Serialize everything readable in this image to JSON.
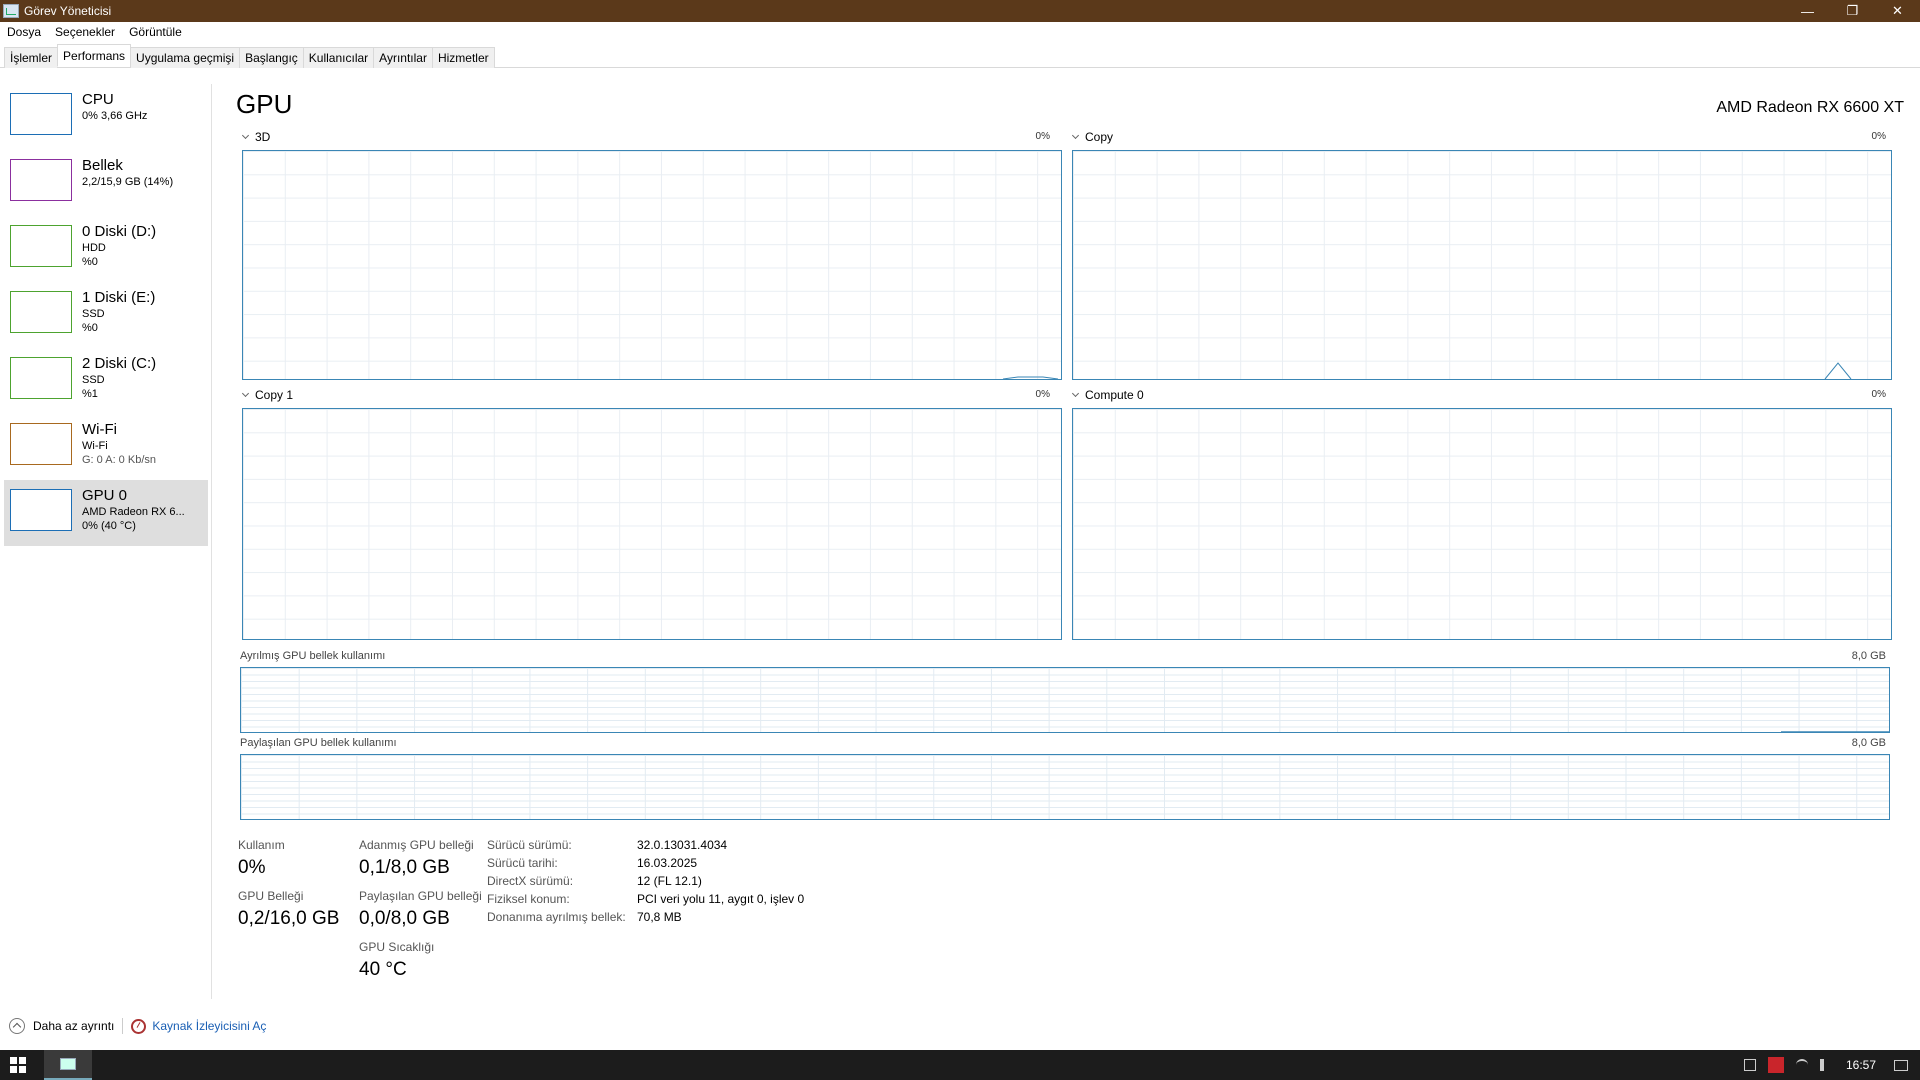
{
  "window": {
    "title": "Görev Yöneticisi",
    "minimize": "—",
    "maximize": "❐",
    "close": "✕"
  },
  "menu": [
    "Dosya",
    "Seçenekler",
    "Görüntüle"
  ],
  "tabs": [
    {
      "label": "İşlemler",
      "active": false
    },
    {
      "label": "Performans",
      "active": true
    },
    {
      "label": "Uygulama geçmişi",
      "active": false
    },
    {
      "label": "Başlangıç",
      "active": false
    },
    {
      "label": "Kullanıcılar",
      "active": false
    },
    {
      "label": "Ayrıntılar",
      "active": false
    },
    {
      "label": "Hizmetler",
      "active": false
    }
  ],
  "sidebar": [
    {
      "name": "CPU",
      "line1": "0% 3,66 GHz",
      "line2": "",
      "color": "#1c6eb5"
    },
    {
      "name": "Bellek",
      "line1": "2,2/15,9 GB (14%)",
      "line2": "",
      "color": "#8b2f9e"
    },
    {
      "name": "0 Diski (D:)",
      "line1": "HDD",
      "line2": "%0",
      "color": "#4da32f"
    },
    {
      "name": "1 Diski (E:)",
      "line1": "SSD",
      "line2": "%0",
      "color": "#4da32f"
    },
    {
      "name": "2 Diski (C:)",
      "line1": "SSD",
      "line2": "%1",
      "color": "#4da32f"
    },
    {
      "name": "Wi-Fi",
      "line1": "Wi-Fi",
      "line2": "G: 0 A: 0 Kb/sn",
      "color": "#a8691f"
    },
    {
      "name": "GPU 0",
      "line1": "AMD Radeon RX 6...",
      "line2": "0% (40 °C)",
      "color": "#1c6eb5"
    }
  ],
  "main": {
    "title": "GPU",
    "model": "AMD Radeon RX 6600 XT",
    "engines": [
      {
        "label": "3D",
        "pct": "0%"
      },
      {
        "label": "Copy",
        "pct": "0%"
      },
      {
        "label": "Copy 1",
        "pct": "0%"
      },
      {
        "label": "Compute 0",
        "pct": "0%"
      }
    ],
    "dedicated_label": "Ayrılmış GPU bellek kullanımı",
    "dedicated_max": "8,0 GB",
    "shared_label": "Paylaşılan GPU bellek kullanımı",
    "shared_max": "8,0 GB"
  },
  "stats": {
    "usage_label": "Kullanım",
    "usage_value": "0%",
    "gpu_mem_label": "GPU Belleği",
    "gpu_mem_value": "0,2/16,0 GB",
    "dedicated_label": "Adanmış GPU belleği",
    "dedicated_value": "0,1/8,0 GB",
    "shared_label": "Paylaşılan GPU belleği",
    "shared_value": "0,0/8,0 GB",
    "temp_label": "GPU Sıcaklığı",
    "temp_value": "40 °C"
  },
  "details": [
    {
      "key": "Sürücü sürümü:",
      "value": "32.0.13031.4034"
    },
    {
      "key": "Sürücü tarihi:",
      "value": "16.03.2025"
    },
    {
      "key": "DirectX sürümü:",
      "value": "12 (FL 12.1)"
    },
    {
      "key": "Fiziksel konum:",
      "value": "PCI veri yolu 11, aygıt 0, işlev 0"
    },
    {
      "key": "Donanıma ayrılmış bellek:",
      "value": "70,8 MB"
    }
  ],
  "footer": {
    "fewer_details": "Daha az ayrıntı",
    "open_monitor": "Kaynak İzleyicisini Aç"
  },
  "taskbar": {
    "clock": "16:57"
  }
}
